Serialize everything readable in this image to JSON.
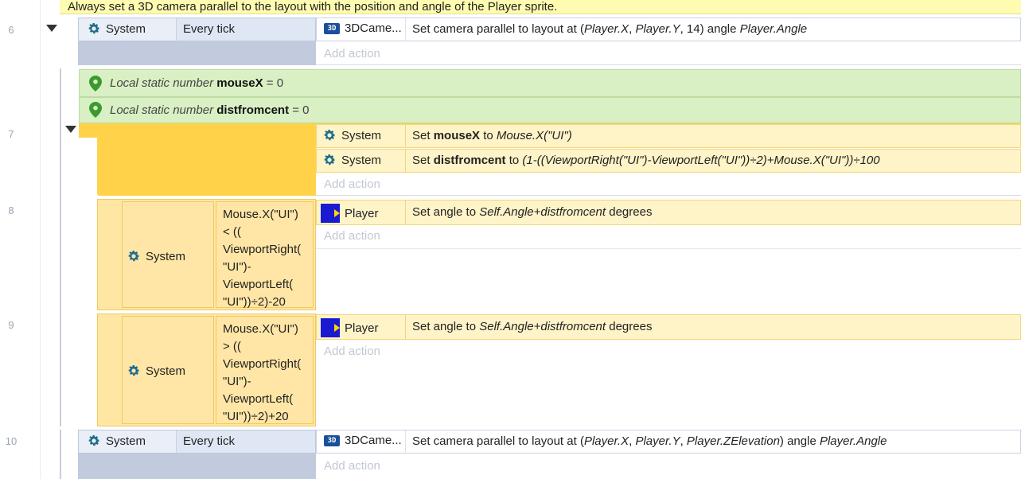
{
  "comment": "Always set a 3D camera parallel to the layout with the position and angle of the Player sprite.",
  "line_numbers": [
    "6",
    "7",
    "8",
    "9",
    "10"
  ],
  "event6": {
    "cond_object": "System",
    "cond_text": "Every tick",
    "act_object": "3DCame...",
    "act_pre": "Set camera parallel to layout at (",
    "act_x": "Player.X",
    "act_sep1": ", ",
    "act_y": "Player.Y",
    "act_mid": ", 14) angle ",
    "act_angle": "Player.Angle",
    "add_action": "Add action"
  },
  "local_vars": [
    {
      "prefix": "Local static number ",
      "name": "mouseX",
      "suffix": " = 0"
    },
    {
      "prefix": "Local static number ",
      "name": "distfromcent",
      "suffix": " = 0"
    }
  ],
  "event7": {
    "actions": [
      {
        "object": "System",
        "verb": "Set ",
        "var": "mouseX",
        "to": " to ",
        "expr": "Mouse.X(\"UI\")"
      },
      {
        "object": "System",
        "verb": "Set ",
        "var": "distfromcent",
        "to": " to ",
        "expr": "(1-((ViewportRight(\"UI\")-ViewportLeft(\"UI\"))÷2)+Mouse.X(\"UI\"))÷100"
      }
    ],
    "add_action": "Add action"
  },
  "event8": {
    "cond_object": "System",
    "cond_lines": [
      "Mouse.X(\"UI\")",
      "< ((",
      "ViewportRight(",
      "\"UI\")-",
      "ViewportLeft(",
      "\"UI\"))÷2)-20"
    ],
    "act_object": "Player",
    "act_pre": "Set angle to ",
    "act_expr": "Self.Angle+distfromcent",
    "act_post": " degrees",
    "add_action": "Add action"
  },
  "event9": {
    "cond_object": "System",
    "cond_lines": [
      "Mouse.X(\"UI\")",
      "> ((",
      "ViewportRight(",
      "\"UI\")-",
      "ViewportLeft(",
      "\"UI\"))÷2)+20"
    ],
    "act_object": "Player",
    "act_pre": "Set angle to ",
    "act_expr": "Self.Angle+distfromcent",
    "act_post": " degrees",
    "add_action": "Add action"
  },
  "event10": {
    "cond_object": "System",
    "cond_text": "Every tick",
    "act_object": "3DCame...",
    "act_pre": "Set camera parallel to layout at (",
    "act_x": "Player.X",
    "act_sep1": ", ",
    "act_y": "Player.Y",
    "act_sep2": ", ",
    "act_z": "Player.ZElevation",
    "act_mid": ") angle ",
    "act_angle": "Player.Angle",
    "add_action": "Add action"
  },
  "icons": {
    "gear": "gear-icon",
    "camera3d": "3d-camera-icon",
    "sprite": "sprite-icon",
    "pin": "location-pin-icon",
    "collapse": "collapse-triangle-icon"
  },
  "icon_text": {
    "camera3d": "3D"
  },
  "colors": {
    "comment_bg": "#fffbb0",
    "condition_blue": "#dfe7f4",
    "local_var_green": "#d9efc4",
    "group_yellow": "#ffd24a",
    "action_yellow": "#fff3c8",
    "gear_teal": "#1f6d8c"
  }
}
